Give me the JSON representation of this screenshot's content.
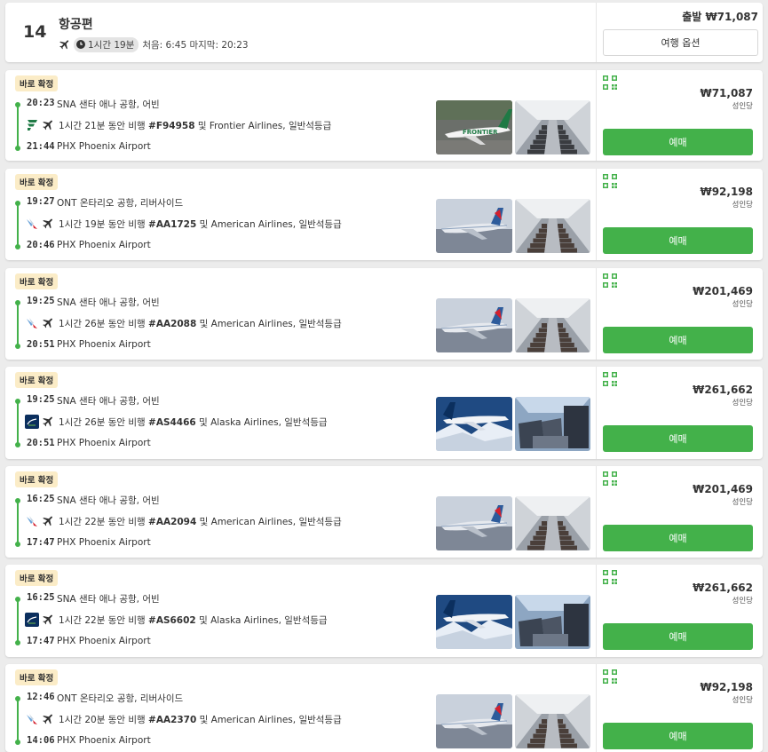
{
  "header": {
    "day": "14",
    "title": "항공편",
    "duration": "1시간 19분",
    "first_last": "처음: 6:45 마지막: 20:23",
    "price_label": "출발 ₩71,087",
    "options_button": "여행 옵션"
  },
  "common": {
    "badge": "바로 확정",
    "book_label": "예매",
    "per_person": "성인당"
  },
  "colors": {
    "green": "#43b14a",
    "badge_bg": "#fbecc7"
  },
  "flights": [
    {
      "dep_time": "20:23",
      "dep_place": "SNA 샌타 애나 공항, 어빈",
      "duration": "1시간 21분",
      "seg_mid": " 동안 비행 ",
      "flight_no": "#F94958",
      "airline_part": " 및 Frontier Airlines, ",
      "cabin": "일반석등급",
      "arr_time": "21:44",
      "arr_place": "PHX Phoenix Airport",
      "price": "₩71,087",
      "airline_icon": "frontier-logo-icon"
    },
    {
      "dep_time": "19:27",
      "dep_place": "ONT 온타리오 공항, 리버사이드",
      "duration": "1시간 19분",
      "seg_mid": " 동안 비행 ",
      "flight_no": "#AA1725",
      "airline_part": " 및 American Airlines, ",
      "cabin": "일반석등급",
      "arr_time": "20:46",
      "arr_place": "PHX Phoenix Airport",
      "price": "₩92,198",
      "airline_icon": "american-logo-icon"
    },
    {
      "dep_time": "19:25",
      "dep_place": "SNA 샌타 애나 공항, 어빈",
      "duration": "1시간 26분",
      "seg_mid": " 동안 비행 ",
      "flight_no": "#AA2088",
      "airline_part": " 및 American Airlines, ",
      "cabin": "일반석등급",
      "arr_time": "20:51",
      "arr_place": "PHX Phoenix Airport",
      "price": "₩201,469",
      "airline_icon": "american-logo-icon"
    },
    {
      "dep_time": "19:25",
      "dep_place": "SNA 샌타 애나 공항, 어빈",
      "duration": "1시간 26분",
      "seg_mid": " 동안 비행 ",
      "flight_no": "#AS4466",
      "airline_part": " 및 Alaska Airlines, ",
      "cabin": "일반석등급",
      "arr_time": "20:51",
      "arr_place": "PHX Phoenix Airport",
      "price": "₩261,662",
      "airline_icon": "alaska-logo-icon"
    },
    {
      "dep_time": "16:25",
      "dep_place": "SNA 샌타 애나 공항, 어빈",
      "duration": "1시간 22분",
      "seg_mid": " 동안 비행 ",
      "flight_no": "#AA2094",
      "airline_part": " 및 American Airlines, ",
      "cabin": "일반석등급",
      "arr_time": "17:47",
      "arr_place": "PHX Phoenix Airport",
      "price": "₩201,469",
      "airline_icon": "american-logo-icon"
    },
    {
      "dep_time": "16:25",
      "dep_place": "SNA 샌타 애나 공항, 어빈",
      "duration": "1시간 22분",
      "seg_mid": " 동안 비행 ",
      "flight_no": "#AS6602",
      "airline_part": " 및 Alaska Airlines, ",
      "cabin": "일반석등급",
      "arr_time": "17:47",
      "arr_place": "PHX Phoenix Airport",
      "price": "₩261,662",
      "airline_icon": "alaska-logo-icon"
    },
    {
      "dep_time": "12:46",
      "dep_place": "ONT 온타리오 공항, 리버사이드",
      "duration": "1시간 20분",
      "seg_mid": " 동안 비행 ",
      "flight_no": "#AA2370",
      "airline_part": " 및 American Airlines, ",
      "cabin": "일반석등급",
      "arr_time": "14:06",
      "arr_place": "PHX Phoenix Airport",
      "price": "₩92,198",
      "airline_icon": "american-logo-icon"
    }
  ]
}
